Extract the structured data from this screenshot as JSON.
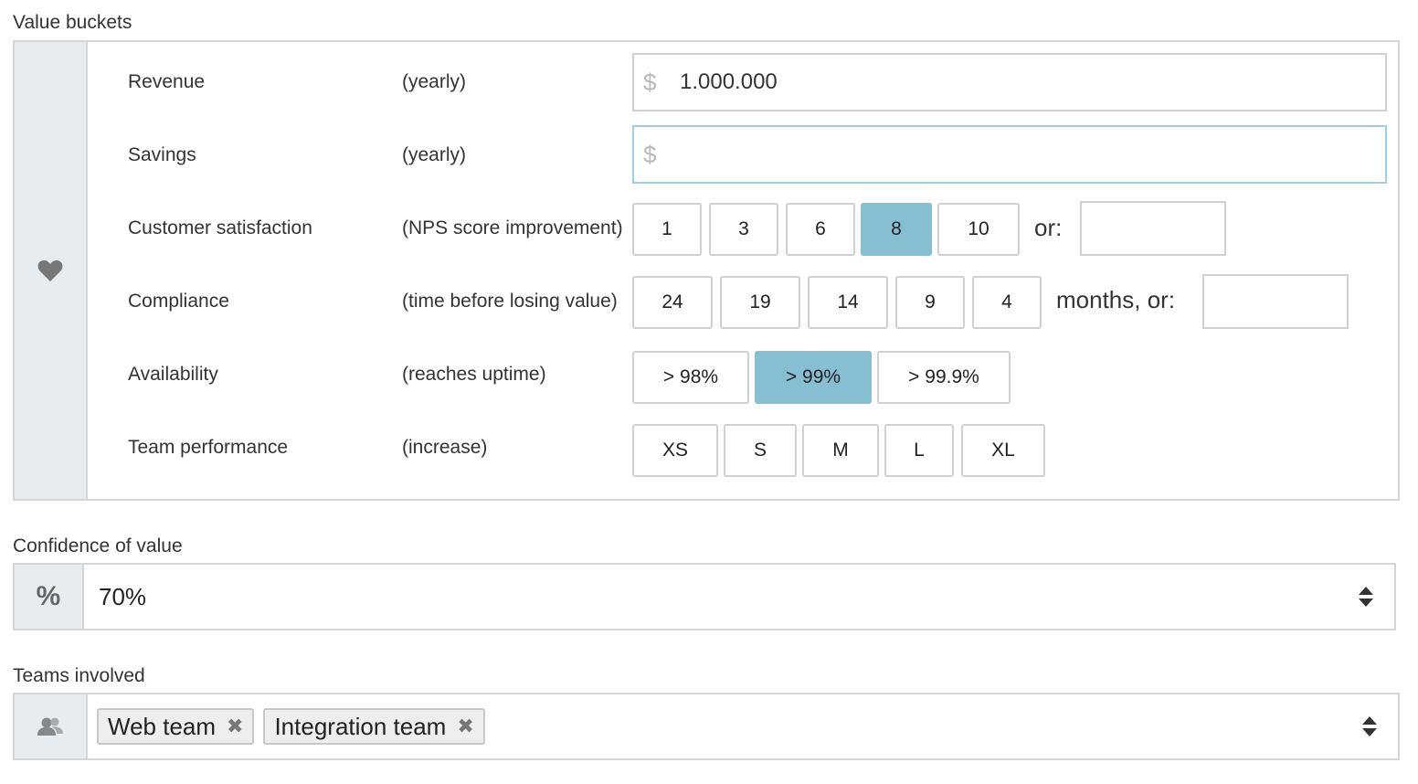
{
  "value_buckets": {
    "title": "Value buckets",
    "icon": "heart-icon",
    "rows": [
      {
        "label": "Revenue",
        "hint": "(yearly)",
        "currency": "$",
        "value": "1.000.000"
      },
      {
        "label": "Savings",
        "hint": "(yearly)",
        "currency": "$",
        "value": ""
      },
      {
        "label": "Customer satisfaction",
        "hint": "(NPS score improvement)",
        "options": [
          "1",
          "3",
          "6",
          "8",
          "10"
        ],
        "selected": "8",
        "suffix": "or:",
        "custom_value": ""
      },
      {
        "label": "Compliance",
        "hint": "(time before losing value)",
        "options": [
          "24",
          "19",
          "14",
          "9",
          "4"
        ],
        "suffix": "months, or:",
        "custom_value": ""
      },
      {
        "label": "Availability",
        "hint": "(reaches uptime)",
        "options": [
          "> 98%",
          "> 99%",
          "> 99.9%"
        ],
        "selected": "> 99%"
      },
      {
        "label": "Team performance",
        "hint": "(increase)",
        "options": [
          "XS",
          "S",
          "M",
          "L",
          "XL"
        ]
      }
    ]
  },
  "confidence": {
    "title": "Confidence of value",
    "icon_text": "%",
    "value": "70%"
  },
  "teams": {
    "title": "Teams involved",
    "icon": "users-icon",
    "tags": [
      "Web team",
      "Integration team"
    ],
    "remove_glyph": "✖"
  },
  "colors": {
    "selected": "#87bfd2",
    "border": "#d6d6d6",
    "side_bg": "#e9ecef",
    "focus_border": "#9fcdea"
  }
}
